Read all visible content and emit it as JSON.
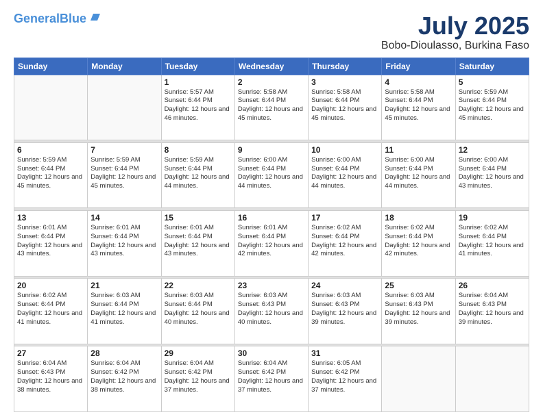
{
  "header": {
    "logo_line1": "General",
    "logo_line2": "Blue",
    "title": "July 2025",
    "subtitle": "Bobo-Dioulasso, Burkina Faso"
  },
  "days_of_week": [
    "Sunday",
    "Monday",
    "Tuesday",
    "Wednesday",
    "Thursday",
    "Friday",
    "Saturday"
  ],
  "weeks": [
    [
      {
        "day": "",
        "info": ""
      },
      {
        "day": "",
        "info": ""
      },
      {
        "day": "1",
        "info": "Sunrise: 5:57 AM\nSunset: 6:44 PM\nDaylight: 12 hours and 46 minutes."
      },
      {
        "day": "2",
        "info": "Sunrise: 5:58 AM\nSunset: 6:44 PM\nDaylight: 12 hours and 45 minutes."
      },
      {
        "day": "3",
        "info": "Sunrise: 5:58 AM\nSunset: 6:44 PM\nDaylight: 12 hours and 45 minutes."
      },
      {
        "day": "4",
        "info": "Sunrise: 5:58 AM\nSunset: 6:44 PM\nDaylight: 12 hours and 45 minutes."
      },
      {
        "day": "5",
        "info": "Sunrise: 5:59 AM\nSunset: 6:44 PM\nDaylight: 12 hours and 45 minutes."
      }
    ],
    [
      {
        "day": "6",
        "info": "Sunrise: 5:59 AM\nSunset: 6:44 PM\nDaylight: 12 hours and 45 minutes."
      },
      {
        "day": "7",
        "info": "Sunrise: 5:59 AM\nSunset: 6:44 PM\nDaylight: 12 hours and 45 minutes."
      },
      {
        "day": "8",
        "info": "Sunrise: 5:59 AM\nSunset: 6:44 PM\nDaylight: 12 hours and 44 minutes."
      },
      {
        "day": "9",
        "info": "Sunrise: 6:00 AM\nSunset: 6:44 PM\nDaylight: 12 hours and 44 minutes."
      },
      {
        "day": "10",
        "info": "Sunrise: 6:00 AM\nSunset: 6:44 PM\nDaylight: 12 hours and 44 minutes."
      },
      {
        "day": "11",
        "info": "Sunrise: 6:00 AM\nSunset: 6:44 PM\nDaylight: 12 hours and 44 minutes."
      },
      {
        "day": "12",
        "info": "Sunrise: 6:00 AM\nSunset: 6:44 PM\nDaylight: 12 hours and 43 minutes."
      }
    ],
    [
      {
        "day": "13",
        "info": "Sunrise: 6:01 AM\nSunset: 6:44 PM\nDaylight: 12 hours and 43 minutes."
      },
      {
        "day": "14",
        "info": "Sunrise: 6:01 AM\nSunset: 6:44 PM\nDaylight: 12 hours and 43 minutes."
      },
      {
        "day": "15",
        "info": "Sunrise: 6:01 AM\nSunset: 6:44 PM\nDaylight: 12 hours and 43 minutes."
      },
      {
        "day": "16",
        "info": "Sunrise: 6:01 AM\nSunset: 6:44 PM\nDaylight: 12 hours and 42 minutes."
      },
      {
        "day": "17",
        "info": "Sunrise: 6:02 AM\nSunset: 6:44 PM\nDaylight: 12 hours and 42 minutes."
      },
      {
        "day": "18",
        "info": "Sunrise: 6:02 AM\nSunset: 6:44 PM\nDaylight: 12 hours and 42 minutes."
      },
      {
        "day": "19",
        "info": "Sunrise: 6:02 AM\nSunset: 6:44 PM\nDaylight: 12 hours and 41 minutes."
      }
    ],
    [
      {
        "day": "20",
        "info": "Sunrise: 6:02 AM\nSunset: 6:44 PM\nDaylight: 12 hours and 41 minutes."
      },
      {
        "day": "21",
        "info": "Sunrise: 6:03 AM\nSunset: 6:44 PM\nDaylight: 12 hours and 41 minutes."
      },
      {
        "day": "22",
        "info": "Sunrise: 6:03 AM\nSunset: 6:44 PM\nDaylight: 12 hours and 40 minutes."
      },
      {
        "day": "23",
        "info": "Sunrise: 6:03 AM\nSunset: 6:43 PM\nDaylight: 12 hours and 40 minutes."
      },
      {
        "day": "24",
        "info": "Sunrise: 6:03 AM\nSunset: 6:43 PM\nDaylight: 12 hours and 39 minutes."
      },
      {
        "day": "25",
        "info": "Sunrise: 6:03 AM\nSunset: 6:43 PM\nDaylight: 12 hours and 39 minutes."
      },
      {
        "day": "26",
        "info": "Sunrise: 6:04 AM\nSunset: 6:43 PM\nDaylight: 12 hours and 39 minutes."
      }
    ],
    [
      {
        "day": "27",
        "info": "Sunrise: 6:04 AM\nSunset: 6:43 PM\nDaylight: 12 hours and 38 minutes."
      },
      {
        "day": "28",
        "info": "Sunrise: 6:04 AM\nSunset: 6:42 PM\nDaylight: 12 hours and 38 minutes."
      },
      {
        "day": "29",
        "info": "Sunrise: 6:04 AM\nSunset: 6:42 PM\nDaylight: 12 hours and 37 minutes."
      },
      {
        "day": "30",
        "info": "Sunrise: 6:04 AM\nSunset: 6:42 PM\nDaylight: 12 hours and 37 minutes."
      },
      {
        "day": "31",
        "info": "Sunrise: 6:05 AM\nSunset: 6:42 PM\nDaylight: 12 hours and 37 minutes."
      },
      {
        "day": "",
        "info": ""
      },
      {
        "day": "",
        "info": ""
      }
    ]
  ]
}
